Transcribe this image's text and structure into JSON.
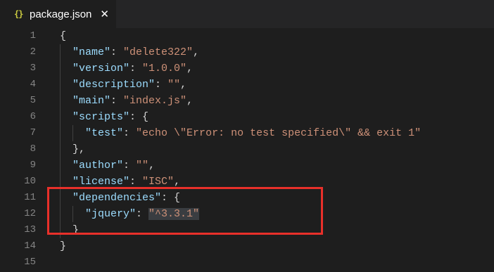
{
  "tab": {
    "icon_text": "{}",
    "filename": "package.json",
    "close_glyph": "✕"
  },
  "lines": [
    {
      "n": "1",
      "code": [
        {
          "t": "{",
          "c": "punc"
        }
      ]
    },
    {
      "n": "2",
      "code": [
        {
          "t": "  ",
          "c": "punc"
        },
        {
          "t": "\"name\"",
          "c": "key"
        },
        {
          "t": ": ",
          "c": "punc"
        },
        {
          "t": "\"delete322\"",
          "c": "str"
        },
        {
          "t": ",",
          "c": "punc"
        }
      ]
    },
    {
      "n": "3",
      "code": [
        {
          "t": "  ",
          "c": "punc"
        },
        {
          "t": "\"version\"",
          "c": "key"
        },
        {
          "t": ": ",
          "c": "punc"
        },
        {
          "t": "\"1.0.0\"",
          "c": "str"
        },
        {
          "t": ",",
          "c": "punc"
        }
      ]
    },
    {
      "n": "4",
      "code": [
        {
          "t": "  ",
          "c": "punc"
        },
        {
          "t": "\"description\"",
          "c": "key"
        },
        {
          "t": ": ",
          "c": "punc"
        },
        {
          "t": "\"\"",
          "c": "str"
        },
        {
          "t": ",",
          "c": "punc"
        }
      ]
    },
    {
      "n": "5",
      "code": [
        {
          "t": "  ",
          "c": "punc"
        },
        {
          "t": "\"main\"",
          "c": "key"
        },
        {
          "t": ": ",
          "c": "punc"
        },
        {
          "t": "\"index.js\"",
          "c": "str"
        },
        {
          "t": ",",
          "c": "punc"
        }
      ]
    },
    {
      "n": "6",
      "code": [
        {
          "t": "  ",
          "c": "punc"
        },
        {
          "t": "\"scripts\"",
          "c": "key"
        },
        {
          "t": ": {",
          "c": "punc"
        }
      ]
    },
    {
      "n": "7",
      "code": [
        {
          "t": "    ",
          "c": "punc"
        },
        {
          "t": "\"test\"",
          "c": "key"
        },
        {
          "t": ": ",
          "c": "punc"
        },
        {
          "t": "\"echo \\\"Error: no test specified\\\" && exit 1\"",
          "c": "str"
        }
      ]
    },
    {
      "n": "8",
      "code": [
        {
          "t": "  },",
          "c": "punc"
        }
      ]
    },
    {
      "n": "9",
      "code": [
        {
          "t": "  ",
          "c": "punc"
        },
        {
          "t": "\"author\"",
          "c": "key"
        },
        {
          "t": ": ",
          "c": "punc"
        },
        {
          "t": "\"\"",
          "c": "str"
        },
        {
          "t": ",",
          "c": "punc"
        }
      ]
    },
    {
      "n": "10",
      "code": [
        {
          "t": "  ",
          "c": "punc"
        },
        {
          "t": "\"license\"",
          "c": "key"
        },
        {
          "t": ": ",
          "c": "punc"
        },
        {
          "t": "\"ISC\"",
          "c": "str"
        },
        {
          "t": ",",
          "c": "punc"
        }
      ]
    },
    {
      "n": "11",
      "code": [
        {
          "t": "  ",
          "c": "punc"
        },
        {
          "t": "\"dependencies\"",
          "c": "key"
        },
        {
          "t": ": {",
          "c": "punc"
        }
      ]
    },
    {
      "n": "12",
      "code": [
        {
          "t": "    ",
          "c": "punc"
        },
        {
          "t": "\"jquery\"",
          "c": "key"
        },
        {
          "t": ": ",
          "c": "punc"
        },
        {
          "t": "\"^3.3.1\"",
          "c": "str sel"
        }
      ]
    },
    {
      "n": "13",
      "code": [
        {
          "t": "  }",
          "c": "punc"
        }
      ]
    },
    {
      "n": "14",
      "code": [
        {
          "t": "}",
          "c": "punc"
        }
      ]
    },
    {
      "n": "15",
      "code": []
    }
  ],
  "colors": {
    "key": "#9cdcfe",
    "string": "#ce9178",
    "annotation_box": "#e8302a"
  }
}
